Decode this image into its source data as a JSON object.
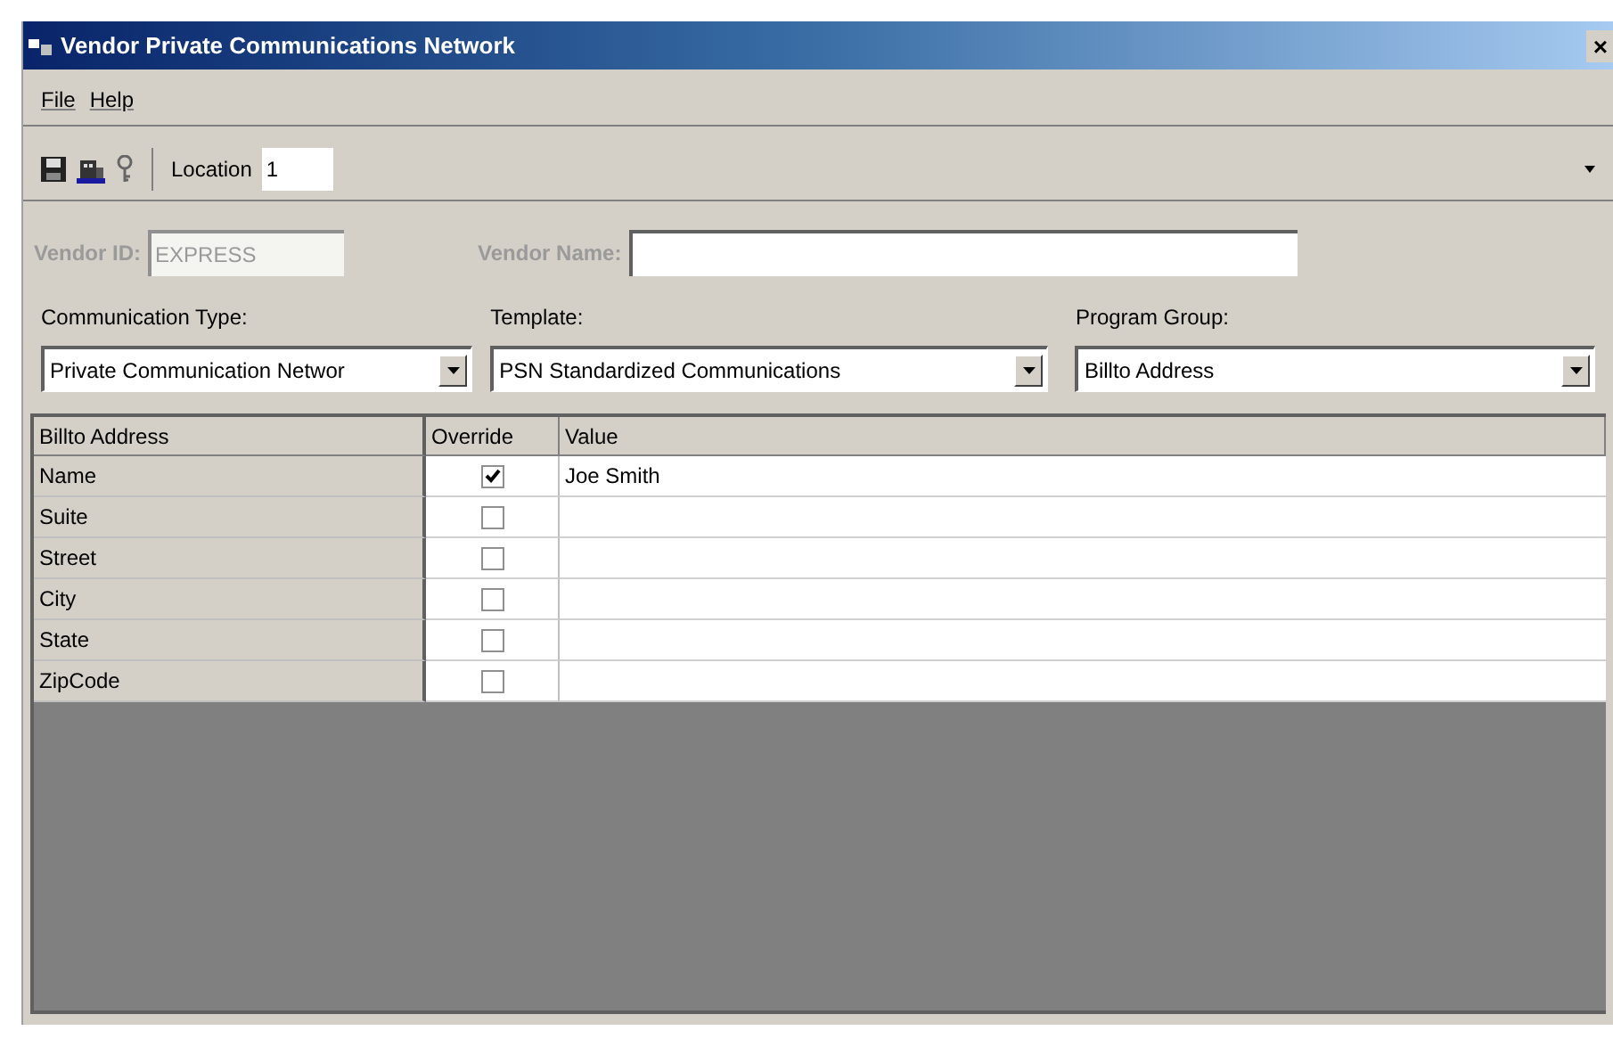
{
  "window": {
    "title": "Vendor Private Communications Network",
    "close": "×"
  },
  "menu": [
    "File",
    "Help"
  ],
  "toolbar": {
    "location_label": "Location",
    "location_value": "1"
  },
  "vendor": {
    "id_label": "Vendor ID:",
    "id_value": "EXPRESS",
    "name_label": "Vendor Name:",
    "disabled": true
  },
  "dropdowns": [
    {
      "label": "Communication Type:",
      "value": "Private Communication Networ"
    },
    {
      "label": "Template:",
      "value": "PSN Standardized Communications"
    },
    {
      "label": "Program Group:",
      "value": "Billto Address"
    }
  ],
  "grid": {
    "columns": [
      "Billto Address",
      "Override",
      "Value"
    ],
    "rows": [
      {
        "field": "Name",
        "checked": true,
        "value": "Joe Smith"
      },
      {
        "field": "Suite",
        "checked": false
      },
      {
        "field": "Street",
        "checked": false
      },
      {
        "field": "City",
        "checked": false
      },
      {
        "field": "State",
        "checked": false
      },
      {
        "field": "ZipCode",
        "checked": false
      }
    ]
  }
}
